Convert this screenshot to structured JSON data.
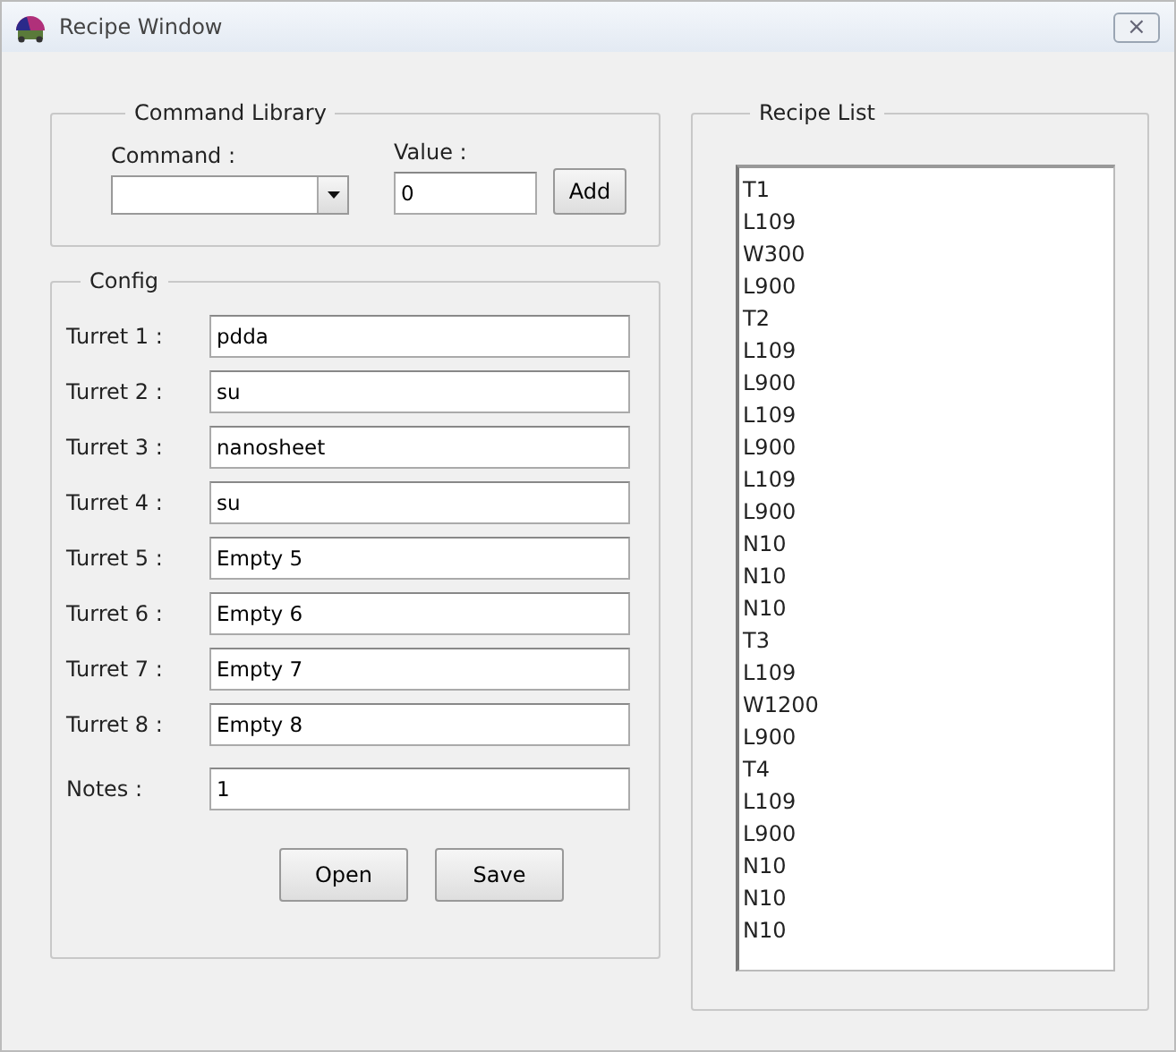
{
  "window": {
    "title": "Recipe Window",
    "close": "×"
  },
  "command_library": {
    "title": "Command Library",
    "command_label": "Command :",
    "value_label": "Value :",
    "value": "0",
    "add_button": "Add"
  },
  "config": {
    "title": "Config",
    "turrets": [
      {
        "label": "Turret 1 :",
        "value": "pdda"
      },
      {
        "label": "Turret 2 :",
        "value": "su"
      },
      {
        "label": "Turret 3 :",
        "value": "nanosheet"
      },
      {
        "label": "Turret 4 :",
        "value": "su"
      },
      {
        "label": "Turret 5 :",
        "value": "Empty 5"
      },
      {
        "label": "Turret 6 :",
        "value": "Empty 6"
      },
      {
        "label": "Turret 7 :",
        "value": "Empty 7"
      },
      {
        "label": "Turret 8 :",
        "value": "Empty 8"
      }
    ],
    "notes_label": "Notes :",
    "notes": "1",
    "buttons": [
      "Open",
      "Save"
    ]
  },
  "recipe_list": {
    "title": "Recipe List",
    "items": [
      "T1",
      "L109",
      "W300",
      "L900",
      "T2",
      "L109",
      "L900",
      "L109",
      "L900",
      "L109",
      "L900",
      "N10",
      "N10",
      "N10",
      "T3",
      "L109",
      "W1200",
      "L900",
      "T4",
      "L109",
      "L900",
      "N10",
      "N10",
      "N10"
    ]
  }
}
